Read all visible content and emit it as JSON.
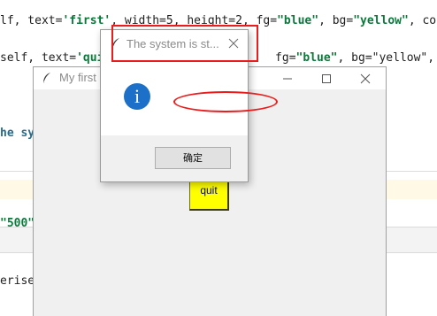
{
  "editor": {
    "lines": [
      {
        "pre": "lf, text=",
        "str1": "'first'",
        "mid": ", width=5, height=2, fg=",
        "str2": "\"blue\"",
        "mid2": ", bg=",
        "str3": "\"yellow\"",
        "post": ", co"
      },
      {
        "pre": "self, text=",
        "str1": "'qui",
        "mid": "",
        "str2": "",
        "mid2": "  fg=",
        "str3": "\"blue\"",
        "post": ", bg=\"yellow\", c"
      },
      {
        "pre": "he sy",
        "str1": "",
        "mid": "",
        "str2": "",
        "mid2": "",
        "str3": "",
        "post": ""
      },
      {
        "pre": "",
        "str1": "",
        "mid": "",
        "str2": "",
        "mid2": "",
        "str3": "",
        "post": ""
      },
      {
        "pre": "",
        "str1": "\"500\"",
        "mid": "",
        "str2": "",
        "mid2": "",
        "str3": "",
        "post": ""
      },
      {
        "pre": "erise",
        "str1": "",
        "mid": "",
        "str2": "",
        "mid2": "",
        "str3": "",
        "post": ""
      }
    ]
  },
  "main_window": {
    "title": "My first",
    "quit_label": "quit",
    "icons": {
      "app": "feather-icon",
      "minimize": "minimize-icon",
      "maximize": "maximize-icon",
      "close": "close-icon"
    }
  },
  "dialog": {
    "title": "The system is st...",
    "info_glyph": "i",
    "ok_label": "确定",
    "icons": {
      "app": "feather-icon",
      "close": "close-icon",
      "info": "info-icon"
    }
  },
  "colors": {
    "annotation": "#ea1c1c",
    "quit_bg": "#ffff00",
    "info_blue": "#1c70c7",
    "code_string": "#0a7a3a"
  }
}
